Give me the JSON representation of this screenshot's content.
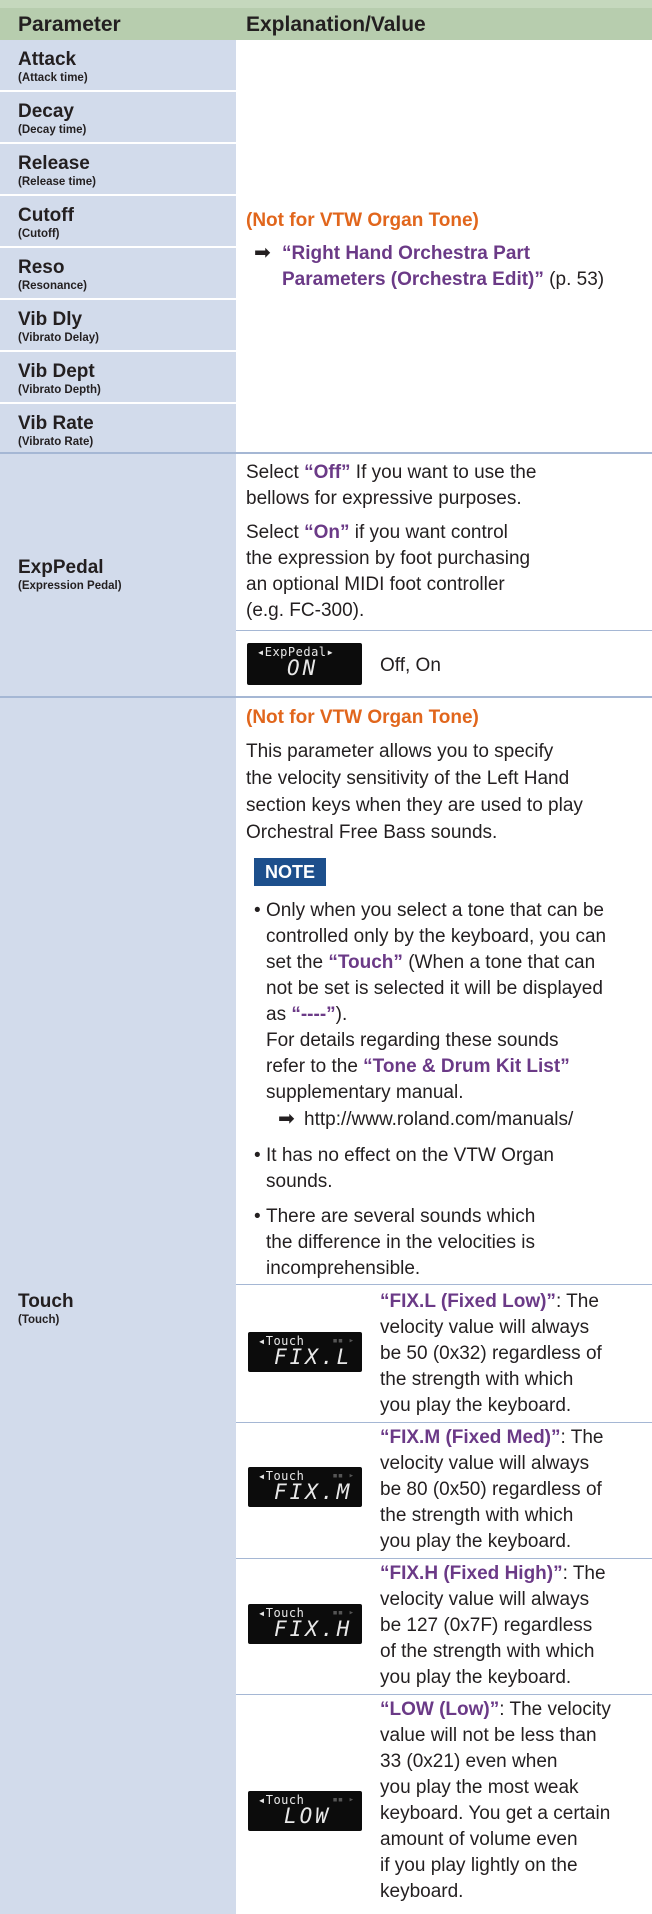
{
  "header": {
    "col1": "Parameter",
    "col2": "Explanation/Value"
  },
  "params": [
    {
      "name": "Attack",
      "sub": "(Attack time)"
    },
    {
      "name": "Decay",
      "sub": "(Decay time)"
    },
    {
      "name": "Release",
      "sub": "(Release time)"
    },
    {
      "name": "Cutoff",
      "sub": "(Cutoff)"
    },
    {
      "name": "Reso",
      "sub": "(Resonance)"
    },
    {
      "name": "Vib Dly",
      "sub": "(Vibrato Delay)"
    },
    {
      "name": "Vib Dept",
      "sub": "(Vibrato Depth)"
    },
    {
      "name": "Vib Rate",
      "sub": "(Vibrato Rate)"
    },
    {
      "name": "ExpPedal",
      "sub": "(Expression Pedal)"
    },
    {
      "name": "Touch",
      "sub": "(Touch)"
    }
  ],
  "orch": {
    "note": "(Not for VTW Organ Tone)",
    "arrow": "➡",
    "ref1": "“Right Hand Orchestra Part",
    "ref2": "Parameters (Orchestra Edit)”",
    "page": " (p. 53)"
  },
  "exppedal": {
    "off_pre": "Select ",
    "off_key": "“Off”",
    "off_post": " If you want to use the",
    "off_line2": "bellows for expressive purposes.",
    "on_pre": "Select ",
    "on_key": "“On”",
    "on_post": " if you want control",
    "on_line2": "the expression by foot purchasing",
    "on_line3": "an optional MIDI foot controller",
    "on_line4": "(e.g. FC-300).",
    "lcd_top": "◂ExpPedal▸",
    "lcd_bottom": "ON",
    "values": "Off, On"
  },
  "touch": {
    "note": "(Not for VTW Organ Tone)",
    "desc": [
      "This parameter allows you to specify",
      "the velocity sensitivity of the Left Hand",
      "section keys when they are used to play",
      "Orchestral Free Bass sounds."
    ],
    "note_label": "NOTE",
    "b1_l1": "Only when you select a tone that can be",
    "b1_l2": "controlled only by the keyboard, you can",
    "b1_l3_pre": "set the ",
    "b1_l3_key": "“Touch”",
    "b1_l3_post": " (When a tone that can",
    "b1_l4": "not be set is selected it will be displayed",
    "b1_l5_pre": "as ",
    "b1_l5_key": "“----”",
    "b1_l5_post": ").",
    "b1_l6": "For details regarding these sounds",
    "b1_l7_pre": "refer to the ",
    "b1_l7_key": "“Tone & Drum Kit List”",
    "b1_l8": "supplementary manual.",
    "b1_url": "http://www.roland.com/manuals/",
    "b2_l1": "It has no effect on the VTW Organ",
    "b2_l2": "sounds.",
    "b3_l1": "There are several sounds which",
    "b3_l2": "the difference in the velocities is",
    "b3_l3": "incomprehensible.",
    "bullet": "•",
    "lcd_top": "◂Touch",
    "options": [
      {
        "lcd": "FIX.L",
        "key": "“FIX.L (Fixed Low)”",
        "lines": [
          ": The",
          "velocity value will always",
          "be 50 (0x32) regardless of",
          "the strength with which",
          "you play the keyboard."
        ]
      },
      {
        "lcd": "FIX.M",
        "key": "“FIX.M (Fixed Med)”",
        "lines": [
          ": The",
          "velocity value will always",
          "be 80 (0x50) regardless of",
          "the strength with which",
          "you play the keyboard."
        ]
      },
      {
        "lcd": "FIX.H",
        "key": "“FIX.H (Fixed High)”",
        "lines": [
          ": The",
          "velocity value will always",
          "be 127 (0x7F) regardless",
          "of the strength with which",
          "you play the keyboard."
        ]
      },
      {
        "lcd": "LOW",
        "key": "“LOW (Low)”",
        "lines": [
          ": The velocity",
          "value will not be less than",
          "33 (0x21) even when",
          "you play the most weak",
          "keyboard. You get a certain",
          "amount of volume even",
          "if you play lightly on the",
          "keyboard."
        ]
      }
    ]
  }
}
